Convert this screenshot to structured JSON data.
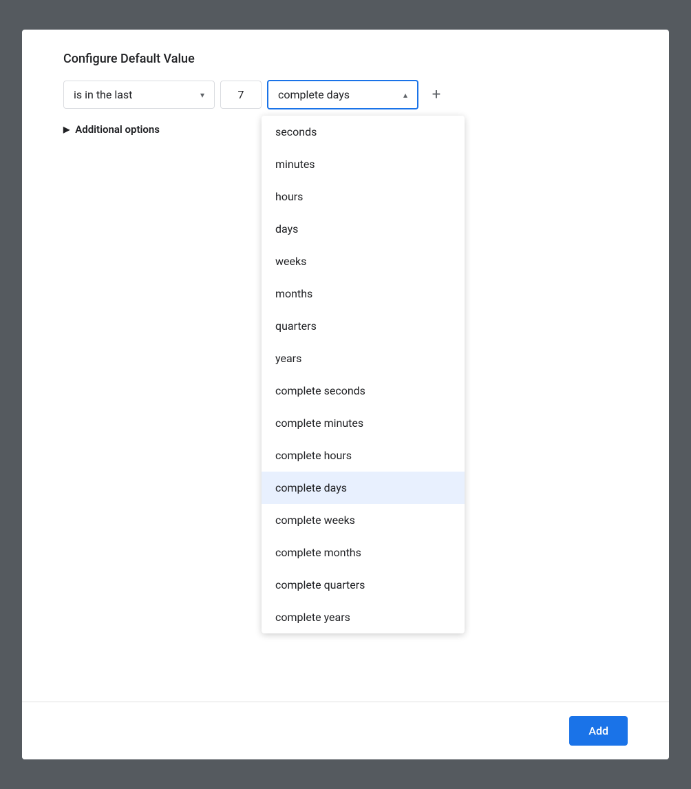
{
  "dialog": {
    "title": "Configure Default Value"
  },
  "filter": {
    "condition_label": "is in the last",
    "condition_chevron": "▾",
    "number_value": "7",
    "selected_unit": "complete days",
    "unit_chevron": "▴",
    "add_icon": "+"
  },
  "additional_options": {
    "arrow": "▶",
    "label": "Additional options"
  },
  "dropdown": {
    "items": [
      {
        "id": "seconds",
        "label": "seconds",
        "selected": false
      },
      {
        "id": "minutes",
        "label": "minutes",
        "selected": false
      },
      {
        "id": "hours",
        "label": "hours",
        "selected": false
      },
      {
        "id": "days",
        "label": "days",
        "selected": false
      },
      {
        "id": "weeks",
        "label": "weeks",
        "selected": false
      },
      {
        "id": "months",
        "label": "months",
        "selected": false
      },
      {
        "id": "quarters",
        "label": "quarters",
        "selected": false
      },
      {
        "id": "years",
        "label": "years",
        "selected": false
      },
      {
        "id": "complete-seconds",
        "label": "complete seconds",
        "selected": false
      },
      {
        "id": "complete-minutes",
        "label": "complete minutes",
        "selected": false
      },
      {
        "id": "complete-hours",
        "label": "complete hours",
        "selected": false
      },
      {
        "id": "complete-days",
        "label": "complete days",
        "selected": true
      },
      {
        "id": "complete-weeks",
        "label": "complete weeks",
        "selected": false
      },
      {
        "id": "complete-months",
        "label": "complete months",
        "selected": false
      },
      {
        "id": "complete-quarters",
        "label": "complete quarters",
        "selected": false
      },
      {
        "id": "complete-years",
        "label": "complete years",
        "selected": false
      }
    ]
  },
  "footer": {
    "add_button_label": "Add"
  }
}
